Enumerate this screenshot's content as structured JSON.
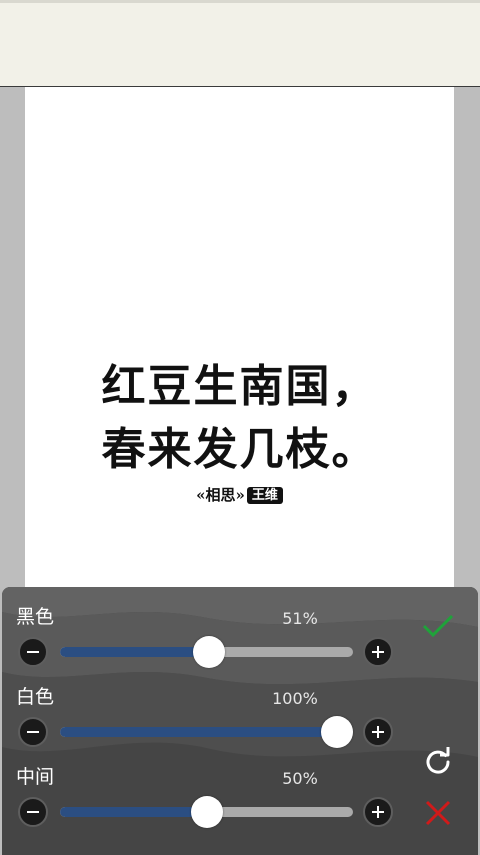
{
  "poem": {
    "line1": "红豆生南国，",
    "line2": "春来发几枝。",
    "title": "«相思»",
    "author": "王维"
  },
  "controls": [
    {
      "label": "黑色",
      "percent_label": "51%",
      "value": 0.51
    },
    {
      "label": "白色",
      "percent_label": "100%",
      "value": 1.0
    },
    {
      "label": "中间",
      "percent_label": "50%",
      "value": 0.5
    }
  ],
  "icons": {
    "minus": "minus-icon",
    "plus": "plus-icon",
    "confirm": "checkmark-icon",
    "reset": "refresh-icon",
    "cancel": "close-icon"
  },
  "colors": {
    "track_fill": "#2b4e82",
    "track_bg": "#aaaaaa",
    "confirm": "#1fa33a",
    "cancel": "#d11a1a"
  }
}
